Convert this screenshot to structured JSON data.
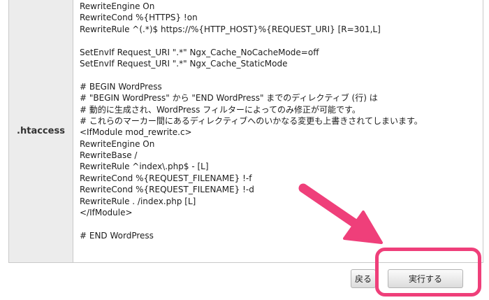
{
  "table": {
    "label": ".htaccess",
    "lines": [
      "RewriteEngine On",
      "RewriteCond %{HTTPS} !on",
      "RewriteRule ^(.*)$ https://%{HTTP_HOST}%{REQUEST_URI} [R=301,L]",
      "",
      "SetEnvIf Request_URI \".*\" Ngx_Cache_NoCacheMode=off",
      "SetEnvIf Request_URI \".*\" Ngx_Cache_StaticMode",
      "",
      "# BEGIN WordPress",
      "# \"BEGIN WordPress\" から \"END WordPress\" までのディレクティブ (行) は",
      "# 動的に生成され、WordPress フィルターによってのみ修正が可能です。",
      "# これらのマーカー間にあるディレクティブへのいかなる変更も上書きされてしまいます。",
      "<IfModule mod_rewrite.c>",
      "RewriteEngine On",
      "RewriteBase /",
      "RewriteRule ^index\\.php$ - [L]",
      "RewriteCond %{REQUEST_FILENAME} !-f",
      "RewriteCond %{REQUEST_FILENAME} !-d",
      "RewriteRule . /index.php [L]",
      "</IfModule>",
      "",
      "# END WordPress"
    ]
  },
  "buttons": {
    "back_label": "戻る",
    "execute_label": "実行する"
  },
  "annotation": {
    "arrow_color": "#ef3f7a",
    "highlight_color": "#ef3f7a"
  }
}
